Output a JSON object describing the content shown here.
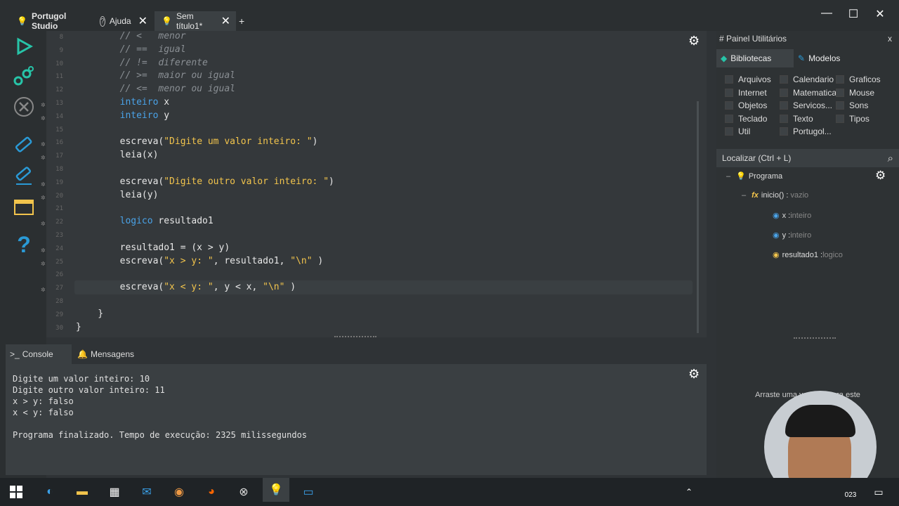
{
  "tabs": [
    {
      "label": "Portugol Studio",
      "icon": "bulb-icon"
    },
    {
      "label": "Ajuda",
      "icon": "help-icon"
    },
    {
      "label": "Sem título1*",
      "icon": "bulb-icon"
    }
  ],
  "add_tab": "+",
  "window": {
    "minimize": "—",
    "maximize": "☐",
    "close": "✕"
  },
  "editor": {
    "lines": [
      {
        "n": "8",
        "bug": false,
        "html": [
          {
            "c": "cm",
            "t": "        // <   menor"
          }
        ]
      },
      {
        "n": "9",
        "bug": false,
        "html": [
          {
            "c": "cm",
            "t": "        // ==  igual"
          }
        ]
      },
      {
        "n": "10",
        "bug": false,
        "html": [
          {
            "c": "cm",
            "t": "        // !=  diferente"
          }
        ]
      },
      {
        "n": "11",
        "bug": false,
        "html": [
          {
            "c": "cm",
            "t": "        // >=  maior ou igual"
          }
        ]
      },
      {
        "n": "12",
        "bug": false,
        "html": [
          {
            "c": "cm",
            "t": "        // <=  menor ou igual"
          }
        ]
      },
      {
        "n": "13",
        "bug": true,
        "html": [
          {
            "c": "",
            "t": "        "
          },
          {
            "c": "kw",
            "t": "inteiro"
          },
          {
            "c": "",
            "t": " x"
          }
        ]
      },
      {
        "n": "14",
        "bug": true,
        "html": [
          {
            "c": "",
            "t": "        "
          },
          {
            "c": "kw",
            "t": "inteiro"
          },
          {
            "c": "",
            "t": " y"
          }
        ]
      },
      {
        "n": "15",
        "bug": false,
        "html": []
      },
      {
        "n": "16",
        "bug": true,
        "html": [
          {
            "c": "",
            "t": "        escreva("
          },
          {
            "c": "st",
            "t": "\"Digite um valor inteiro: \""
          },
          {
            "c": "",
            "t": ")"
          }
        ]
      },
      {
        "n": "17",
        "bug": true,
        "html": [
          {
            "c": "",
            "t": "        leia(x)"
          }
        ]
      },
      {
        "n": "18",
        "bug": false,
        "html": []
      },
      {
        "n": "19",
        "bug": true,
        "html": [
          {
            "c": "",
            "t": "        escreva("
          },
          {
            "c": "st",
            "t": "\"Digite outro valor inteiro: \""
          },
          {
            "c": "",
            "t": ")"
          }
        ]
      },
      {
        "n": "20",
        "bug": true,
        "html": [
          {
            "c": "",
            "t": "        leia(y)"
          }
        ]
      },
      {
        "n": "21",
        "bug": false,
        "html": []
      },
      {
        "n": "22",
        "bug": true,
        "html": [
          {
            "c": "",
            "t": "        "
          },
          {
            "c": "kw",
            "t": "logico"
          },
          {
            "c": "",
            "t": " resultado1"
          }
        ]
      },
      {
        "n": "23",
        "bug": false,
        "html": []
      },
      {
        "n": "24",
        "bug": true,
        "html": [
          {
            "c": "",
            "t": "        resultado1 = (x > y)"
          }
        ]
      },
      {
        "n": "25",
        "bug": true,
        "html": [
          {
            "c": "",
            "t": "        escreva("
          },
          {
            "c": "st",
            "t": "\"x > y: \""
          },
          {
            "c": "",
            "t": ", resultado1, "
          },
          {
            "c": "st",
            "t": "\"\\n\""
          },
          {
            "c": "",
            "t": " )"
          }
        ]
      },
      {
        "n": "26",
        "bug": false,
        "html": []
      },
      {
        "n": "27",
        "bug": true,
        "html": [
          {
            "c": "",
            "t": "        escreva("
          },
          {
            "c": "st",
            "t": "\"x < y: \""
          },
          {
            "c": "",
            "t": ", y < x, "
          },
          {
            "c": "st",
            "t": "\"\\n\""
          },
          {
            "c": "",
            "t": " )"
          }
        ]
      },
      {
        "n": "28",
        "bug": false,
        "html": []
      },
      {
        "n": "29",
        "bug": false,
        "html": [
          {
            "c": "",
            "t": "    }"
          }
        ]
      },
      {
        "n": "30",
        "bug": false,
        "html": [
          {
            "c": "",
            "t": "}"
          }
        ]
      }
    ]
  },
  "panel": {
    "title": "# Painel Utilitários",
    "close": "x",
    "tabs": [
      "Bibliotecas",
      "Modelos"
    ],
    "libraries": [
      [
        "Arquivos",
        "Calendario",
        "Graficos"
      ],
      [
        "Internet",
        "Matematica",
        "Mouse"
      ],
      [
        "Objetos",
        "Servicos...",
        "Sons"
      ],
      [
        "Teclado",
        "Texto",
        "Tipos"
      ],
      [
        "Util",
        "Portugol...",
        ""
      ]
    ],
    "search_placeholder": "Localizar (Ctrl + L)",
    "tree": {
      "root": "Programa",
      "func": "inicio() :",
      "func_type": "vazio",
      "vars": [
        {
          "name": "x :",
          "type": "inteiro",
          "color": "#4aa3e8"
        },
        {
          "name": "y :",
          "type": "inteiro",
          "color": "#4aa3e8"
        },
        {
          "name": "resultado1 :",
          "type": "logico",
          "color": "#f2c44c"
        }
      ]
    },
    "hint": "Arraste uma variável para este painél s..."
  },
  "console": {
    "tabs": [
      "Console",
      "Mensagens"
    ],
    "lines": [
      "Digite um valor inteiro: 10",
      "Digite outro valor inteiro: 11",
      "x > y: falso",
      "x < y: falso",
      "",
      "Programa finalizado. Tempo de execução: 2325 milissegundos"
    ]
  },
  "taskbar": {
    "clock": "023"
  }
}
